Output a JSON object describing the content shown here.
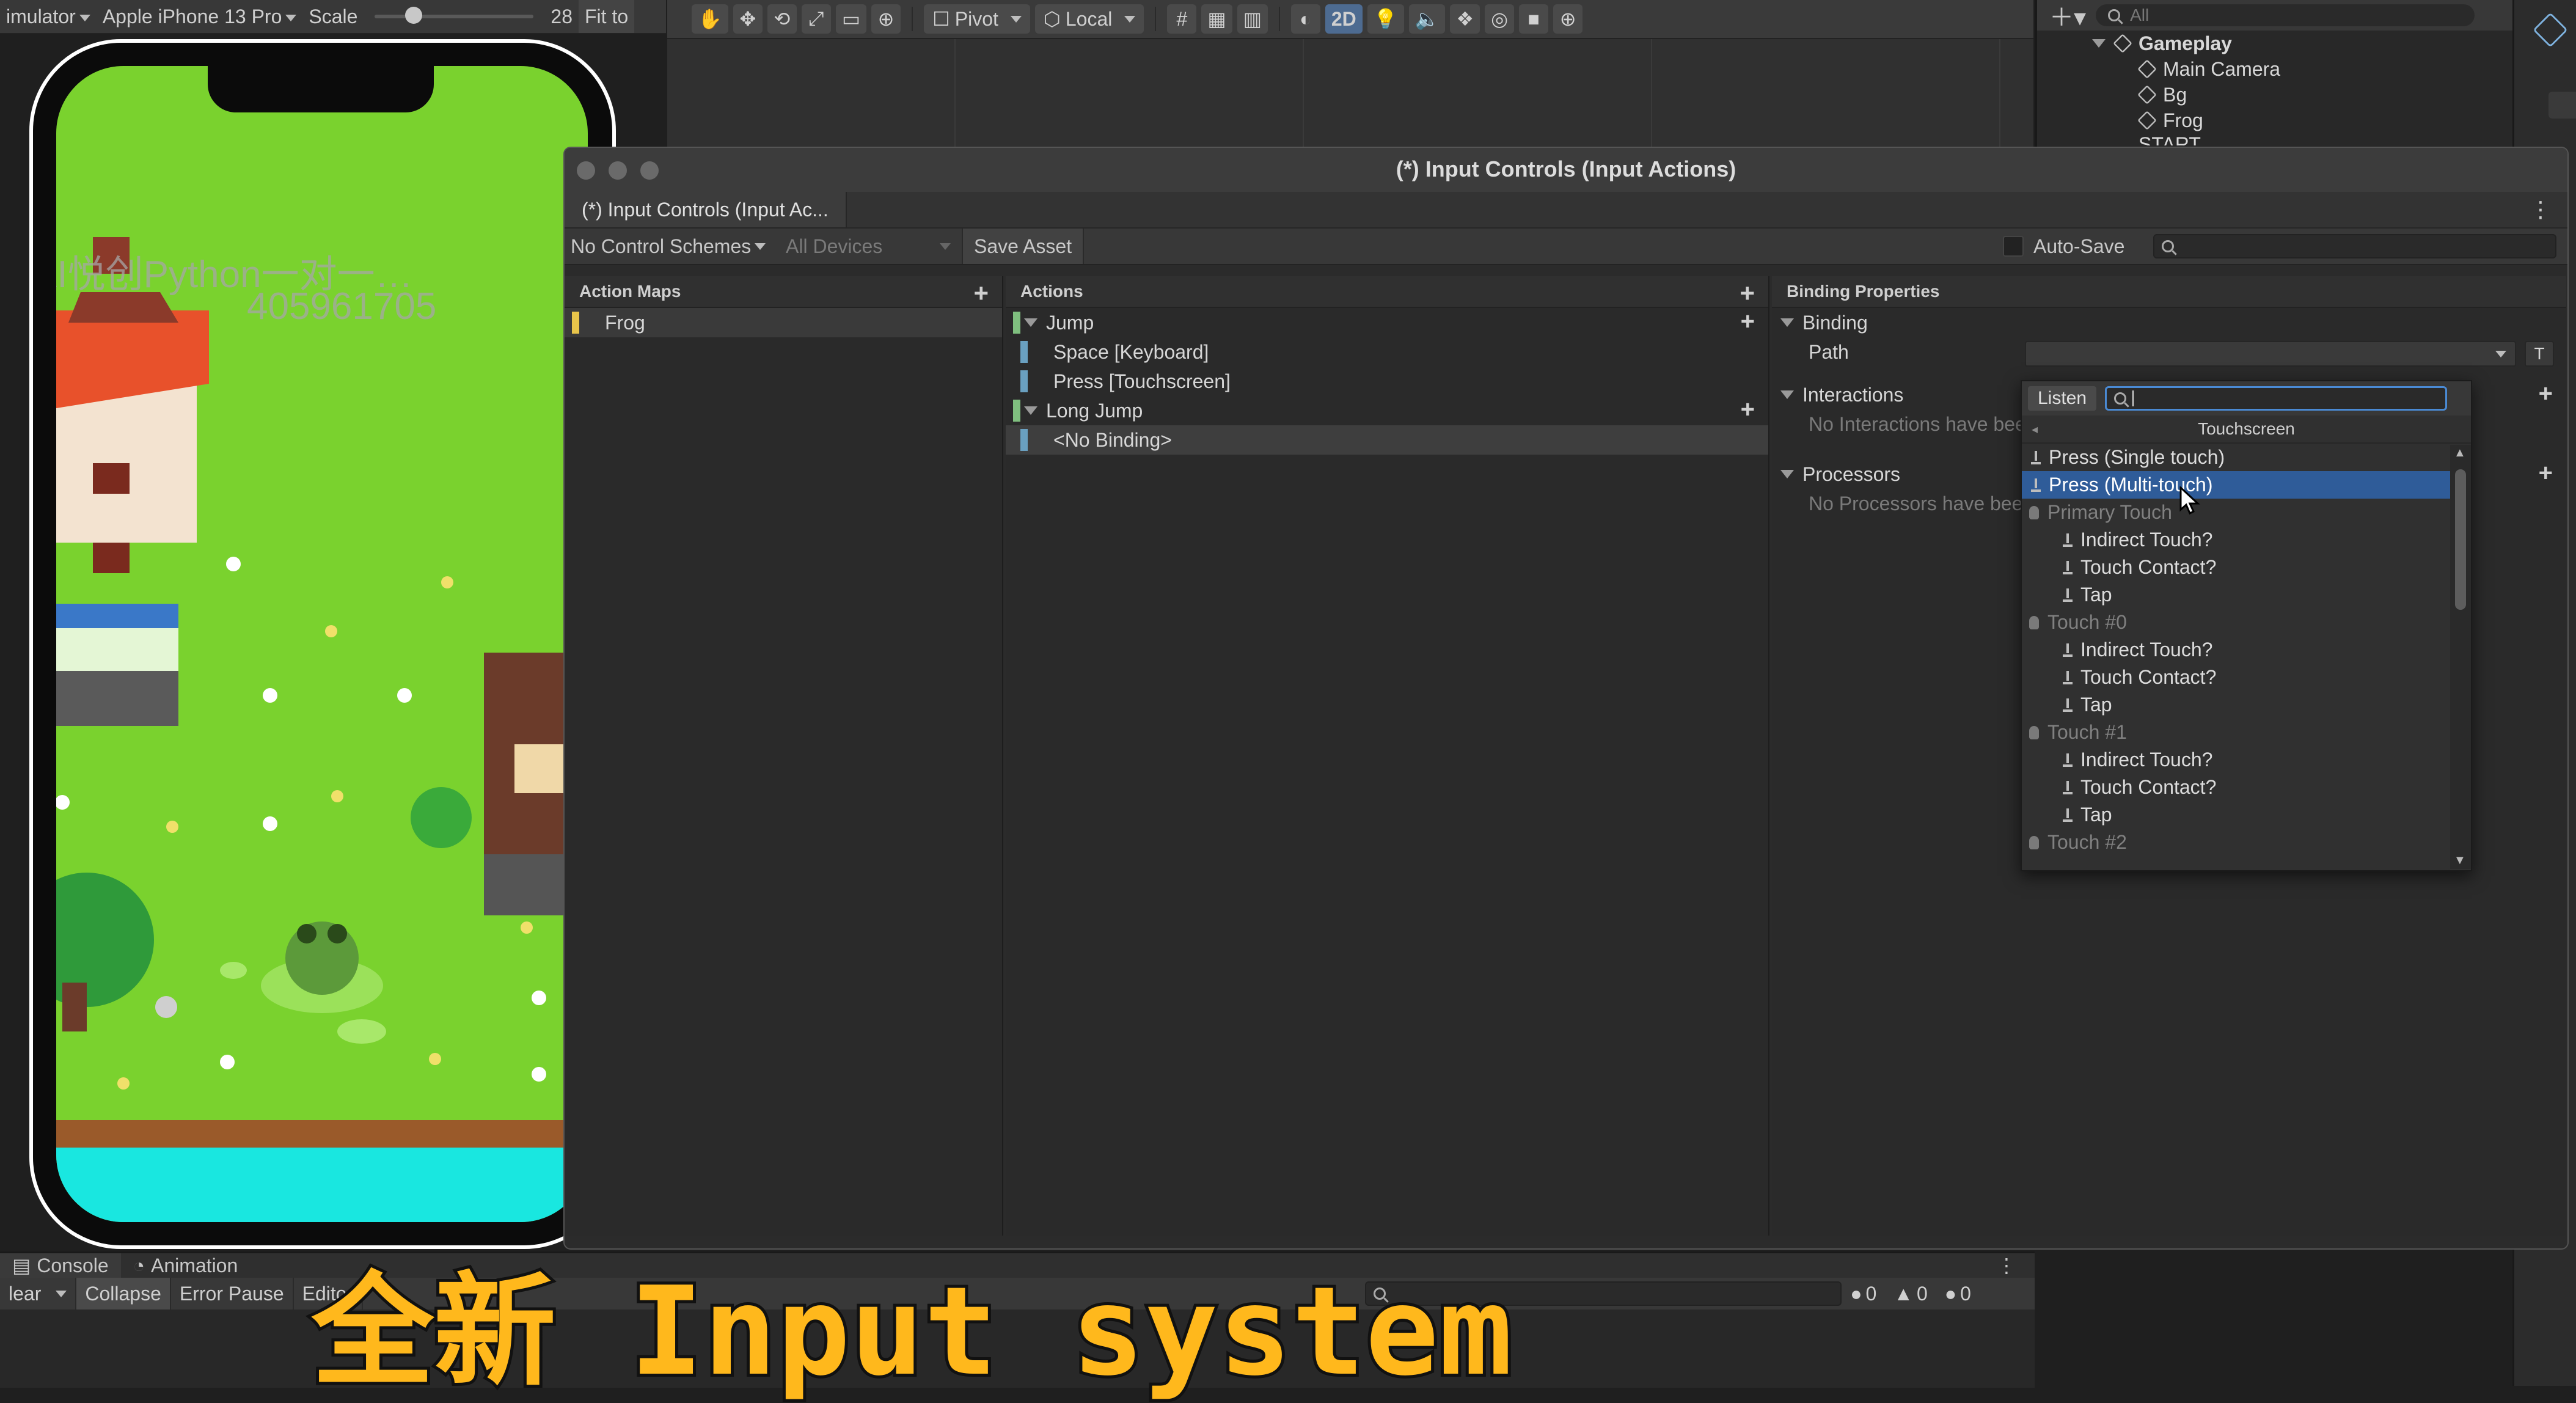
{
  "simulator_toolbar": {
    "mode_label": "imulator",
    "device": "Apple iPhone 13 Pro",
    "scale_label": "Scale",
    "scale_value": "28",
    "fit_label": "Fit to"
  },
  "scene_toolbar": {
    "pivot_label": "Pivot",
    "local_label": "Local",
    "mode_2d_label": "2D"
  },
  "hierarchy": {
    "search_placeholder": "All",
    "scene_name": "Gameplay",
    "items": [
      "Main Camera",
      "Bg",
      "Frog",
      "START"
    ]
  },
  "watermark": {
    "line1": "AI悦创Python一对一…",
    "line2": "405961705"
  },
  "input_actions": {
    "window_title": "(*) Input Controls (Input Actions)",
    "tab_label": "(*) Input Controls (Input Ac...",
    "control_schemes": "No Control Schemes",
    "devices": "All Devices",
    "save_asset": "Save Asset",
    "auto_save": "Auto-Save",
    "action_maps_header": "Action Maps",
    "action_maps": [
      "Frog"
    ],
    "actions_header": "Actions",
    "actions": [
      {
        "name": "Jump",
        "bindings": [
          "Space [Keyboard]",
          "Press [Touchscreen]"
        ]
      },
      {
        "name": "Long Jump",
        "bindings": [
          "<No Binding>"
        ]
      }
    ],
    "properties_header": "Binding Properties",
    "binding_label": "Binding",
    "path_label": "Path",
    "path_t_button": "T",
    "interactions_label": "Interactions",
    "interactions_empty": "No Interactions have bee",
    "processors_label": "Processors",
    "processors_empty": "No Processors have bee"
  },
  "dropdown": {
    "listen_label": "Listen",
    "search_value": "",
    "category": "Touchscreen",
    "items": [
      {
        "label": "Press (Single touch)",
        "type": "bind",
        "indent": 0,
        "selected": false
      },
      {
        "label": "Press (Multi-touch)",
        "type": "bind",
        "indent": 0,
        "selected": true
      },
      {
        "label": "Primary Touch",
        "type": "group",
        "indent": 0,
        "selected": false
      },
      {
        "label": "Indirect Touch?",
        "type": "bind",
        "indent": 1,
        "selected": false
      },
      {
        "label": "Touch Contact?",
        "type": "bind",
        "indent": 1,
        "selected": false
      },
      {
        "label": "Tap",
        "type": "bind",
        "indent": 1,
        "selected": false
      },
      {
        "label": "Touch #0",
        "type": "group",
        "indent": 0,
        "selected": false
      },
      {
        "label": "Indirect Touch?",
        "type": "bind",
        "indent": 1,
        "selected": false
      },
      {
        "label": "Touch Contact?",
        "type": "bind",
        "indent": 1,
        "selected": false
      },
      {
        "label": "Tap",
        "type": "bind",
        "indent": 1,
        "selected": false
      },
      {
        "label": "Touch #1",
        "type": "group",
        "indent": 0,
        "selected": false
      },
      {
        "label": "Indirect Touch?",
        "type": "bind",
        "indent": 1,
        "selected": false
      },
      {
        "label": "Touch Contact?",
        "type": "bind",
        "indent": 1,
        "selected": false
      },
      {
        "label": "Tap",
        "type": "bind",
        "indent": 1,
        "selected": false
      },
      {
        "label": "Touch #2",
        "type": "group",
        "indent": 0,
        "selected": false
      }
    ]
  },
  "console": {
    "tab_console": "Console",
    "tab_animation": "Animation",
    "clear_label": "lear",
    "collapse_label": "Collapse",
    "error_pause_label": "Error Pause",
    "editor_label": "Editor",
    "count_info": "0",
    "count_warn": "0",
    "count_error": "0"
  },
  "subtitle": "全新 Input system",
  "colors": {
    "selected_blue": "#2f5c99",
    "map_bar": "#e8c44a",
    "action_bar": "#7fbf7f",
    "binding_bar": "#6aa0c0",
    "subtitle": "#ffb81c"
  }
}
